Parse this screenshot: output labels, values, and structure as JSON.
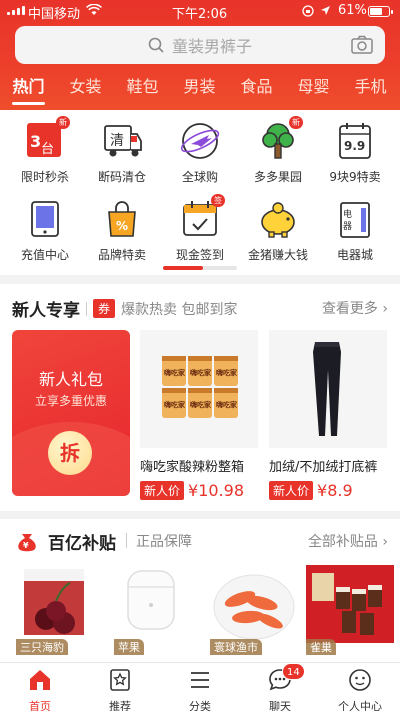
{
  "status": {
    "carrier": "中国移动",
    "time": "下午2:06",
    "battery": "61%"
  },
  "search": {
    "placeholder": "童装男裤子"
  },
  "categories": [
    {
      "label": "热门",
      "active": true
    },
    {
      "label": "女装"
    },
    {
      "label": "鞋包"
    },
    {
      "label": "男装"
    },
    {
      "label": "食品"
    },
    {
      "label": "母婴"
    },
    {
      "label": "手机"
    }
  ],
  "grid": {
    "items": [
      {
        "label": "限时秒杀",
        "badge": "新"
      },
      {
        "label": "断码清仓",
        "icon_text": "清"
      },
      {
        "label": "全球购"
      },
      {
        "label": "多多果园",
        "badge": "新"
      },
      {
        "label": "9块9特卖",
        "icon_text": "9.9"
      },
      {
        "label": "充值中心"
      },
      {
        "label": "品牌特卖"
      },
      {
        "label": "现金签到",
        "badge": "签"
      },
      {
        "label": "金猪赚大钱"
      },
      {
        "label": "电器城",
        "icon_text": "电器"
      }
    ]
  },
  "new_user": {
    "title": "新人专享",
    "coupon": "券",
    "subtitle": "爆款热卖 包邮到家",
    "more": "查看更多",
    "gift": {
      "line1": "新人礼包",
      "line2": "立享多重优惠",
      "coin": "拆"
    },
    "products": [
      {
        "name": "嗨吃家酸辣粉整箱",
        "tag": "新人价",
        "price": "¥10.98",
        "brand_text": "嗨吃家"
      },
      {
        "name": "加绒/不加绒打底裤",
        "tag": "新人价",
        "price": "¥8.9"
      }
    ]
  },
  "subsidy": {
    "title": "百亿补贴",
    "subtitle": "正品保障",
    "more": "全部补贴品",
    "items": [
      {
        "caption": "三只海豹"
      },
      {
        "caption": "苹果"
      },
      {
        "caption": "寰球渔市"
      },
      {
        "caption": "雀巢"
      }
    ]
  },
  "tabbar": {
    "tabs": [
      {
        "label": "首页",
        "active": true
      },
      {
        "label": "推荐"
      },
      {
        "label": "分类"
      },
      {
        "label": "聊天",
        "count": "14"
      },
      {
        "label": "个人中心"
      }
    ]
  },
  "colors": {
    "brand": "#e8332a"
  }
}
